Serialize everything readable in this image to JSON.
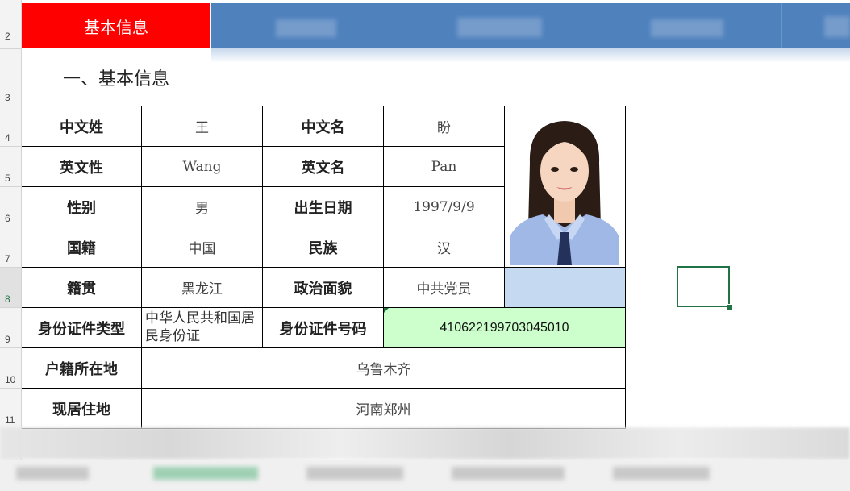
{
  "banner": {
    "title": "基本信息"
  },
  "section": {
    "title": "一、基本信息"
  },
  "rows": [
    "2",
    "3",
    "4",
    "5",
    "6",
    "7",
    "8",
    "9",
    "10",
    "11"
  ],
  "table": {
    "labels": {
      "surname_cn": "中文姓",
      "givenname_cn": "中文名",
      "surname_en": "英文性",
      "givenname_en": "英文名",
      "gender": "性别",
      "birthdate": "出生日期",
      "nationality": "国籍",
      "ethnicity": "民族",
      "native_place": "籍贯",
      "political_status": "政治面貌",
      "id_type": "身份证件类型",
      "id_number": "身份证件号码",
      "household_address": "户籍所在地",
      "current_address": "现居住地"
    },
    "values": {
      "surname_cn": "王",
      "givenname_cn": "盼",
      "surname_en": "Wang",
      "givenname_en": "Pan",
      "gender": "男",
      "birthdate": "1997/9/9",
      "nationality": "中国",
      "ethnicity": "汉",
      "native_place": "黑龙江",
      "political_status": "中共党员",
      "id_type": "中华人民共和国居民身份证",
      "id_number": "410622199703045010",
      "household_address": "乌鲁木齐",
      "current_address": "河南郑州"
    }
  },
  "colors": {
    "banner_red": "#ff0000",
    "banner_blue": "#4f81bd",
    "id_number_bg": "#ccffcc",
    "photo_blank_bg": "#c5d9f1",
    "selection": "#217346"
  }
}
